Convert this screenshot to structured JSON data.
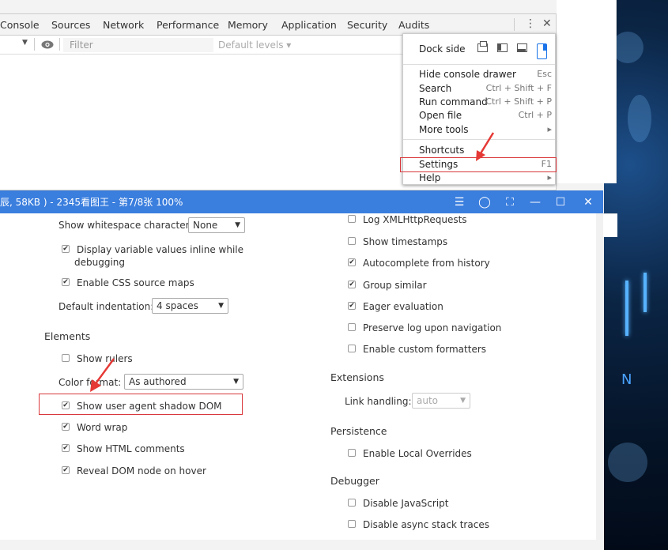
{
  "devtools": {
    "tabs": [
      "Console",
      "Sources",
      "Network",
      "Performance",
      "Memory",
      "Application",
      "Security",
      "Audits"
    ],
    "filter_placeholder": "Filter",
    "default_levels": "Default levels ▾",
    "context_selector_arrow": "▼"
  },
  "menu": {
    "dock_side_label": "Dock side",
    "items": [
      {
        "label": "Hide console drawer",
        "shortcut": "Esc"
      },
      {
        "label": "Search",
        "shortcut": "Ctrl + Shift + F"
      },
      {
        "label": "Run command",
        "shortcut": "Ctrl + Shift + P"
      },
      {
        "label": "Open file",
        "shortcut": "Ctrl + P"
      },
      {
        "label": "More tools",
        "shortcut": "▸"
      },
      {
        "label": "Shortcuts",
        "shortcut": ""
      },
      {
        "label": "Settings",
        "shortcut": "F1"
      },
      {
        "label": "Help",
        "shortcut": "▸"
      }
    ]
  },
  "viewer": {
    "title": "辰, 58KB ) - 2345看图王 - 第7/8张 100%",
    "controls": [
      "☰",
      "◯",
      "⛶",
      "—",
      "☐",
      "✕"
    ]
  },
  "settings": {
    "left": {
      "whitespace_label": "Show whitespace characters:",
      "whitespace_value": "None",
      "inline_values": "Display variable values inline while debugging",
      "inline_values_line1": "Display variable values inline while",
      "inline_values_line2": "debugging",
      "css_source_maps": "Enable CSS source maps",
      "indentation_label": "Default indentation:",
      "indentation_value": "4 spaces",
      "elements_heading": "Elements",
      "show_rulers": "Show rulers",
      "color_format_label": "Color format:",
      "color_format_value": "As authored",
      "shadow_dom": "Show user agent shadow DOM",
      "word_wrap": "Word wrap",
      "html_comments": "Show HTML comments",
      "reveal_dom": "Reveal DOM node on hover"
    },
    "right": {
      "log_xhr": "Log XMLHttpRequests",
      "timestamps": "Show timestamps",
      "autocomplete": "Autocomplete from history",
      "group_similar": "Group similar",
      "eager_eval": "Eager evaluation",
      "preserve_log": "Preserve log upon navigation",
      "custom_formatters": "Enable custom formatters",
      "extensions_heading": "Extensions",
      "link_handling_label": "Link handling:",
      "link_handling_value": "auto",
      "persistence_heading": "Persistence",
      "local_overrides": "Enable Local Overrides",
      "debugger_heading": "Debugger",
      "disable_js": "Disable JavaScript",
      "disable_async": "Disable async stack traces"
    }
  },
  "colors": {
    "accent_blue": "#3a7ede",
    "highlight_red": "#d9383c",
    "arrow_red": "#e53935"
  }
}
